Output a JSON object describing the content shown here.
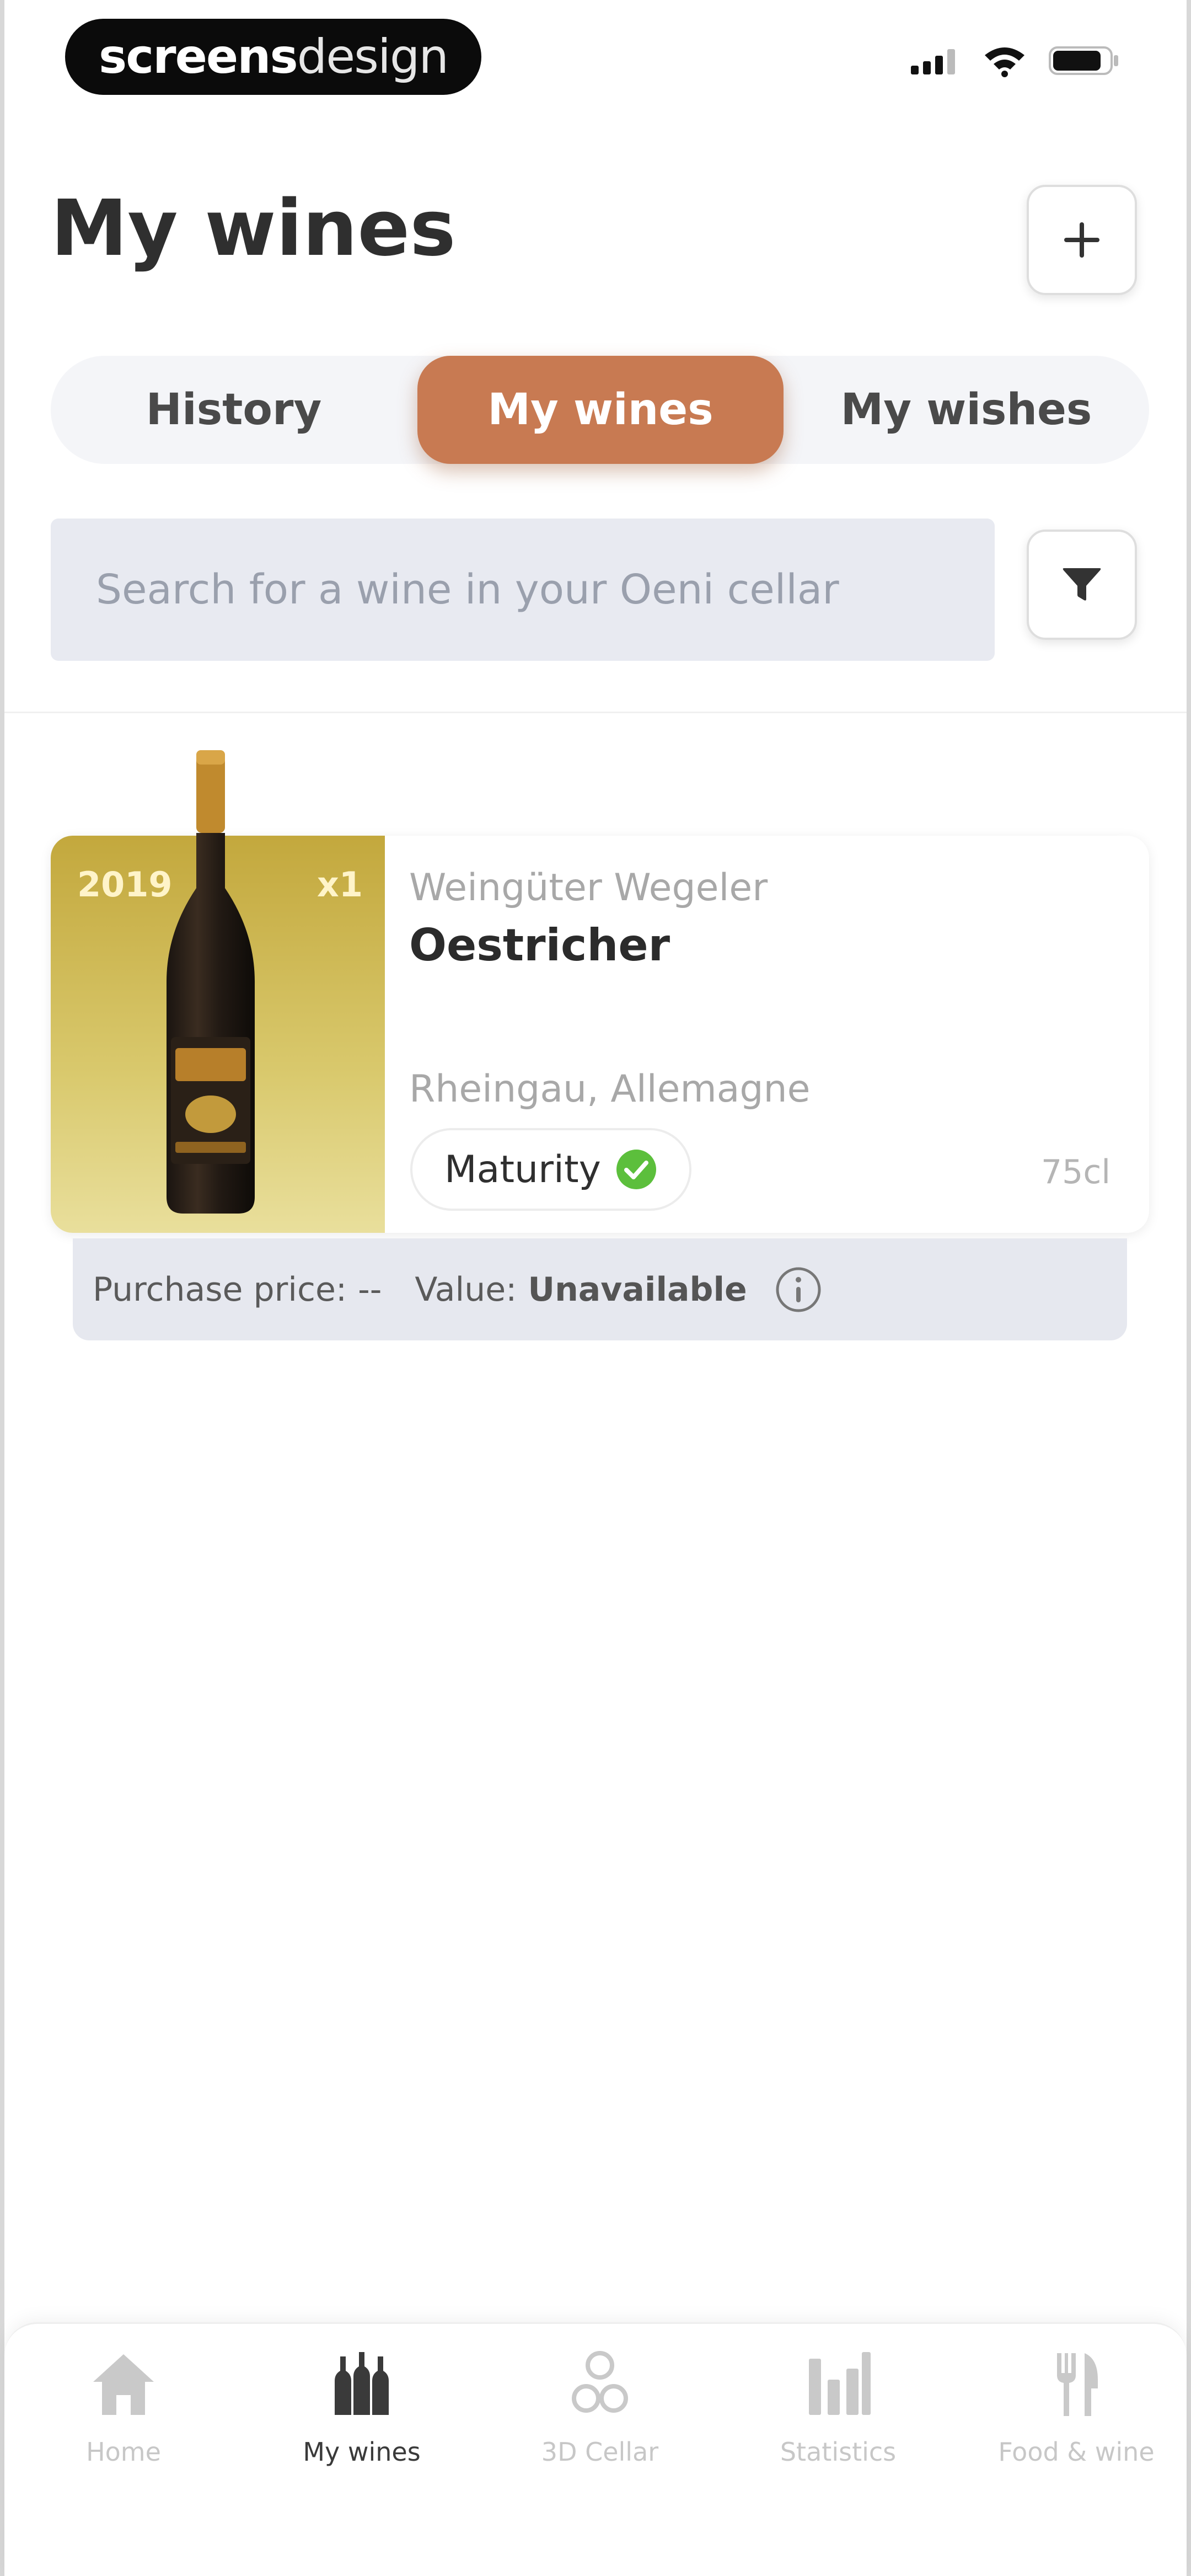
{
  "watermark": {
    "part1": "screens",
    "part2": "design"
  },
  "header": {
    "title": "My wines"
  },
  "tabs": [
    {
      "label": "History"
    },
    {
      "label": "My wines"
    },
    {
      "label": "My wishes"
    }
  ],
  "search": {
    "placeholder": "Search for a wine in your Oeni cellar"
  },
  "wine": {
    "vintage": "2019",
    "quantity": "x1",
    "producer": "Weingüter Wegeler",
    "name": "Oestricher",
    "region": "Rheingau, Allemagne",
    "maturity_label": "Maturity",
    "volume": "75cl",
    "purchase_price_label": "Purchase price:",
    "purchase_price_value": "--",
    "value_label": "Value:",
    "value_value": "Unavailable"
  },
  "nav": [
    {
      "label": "Home",
      "icon": "home-icon"
    },
    {
      "label": "My wines",
      "icon": "bottles-icon"
    },
    {
      "label": "3D Cellar",
      "icon": "cellar-icon"
    },
    {
      "label": "Statistics",
      "icon": "bar-chart-icon"
    },
    {
      "label": "Food & wine",
      "icon": "fork-knife-icon"
    }
  ],
  "colors": {
    "accent": "#c87a52",
    "label_bg": "#c3a83d",
    "check": "#5cbf3c"
  }
}
